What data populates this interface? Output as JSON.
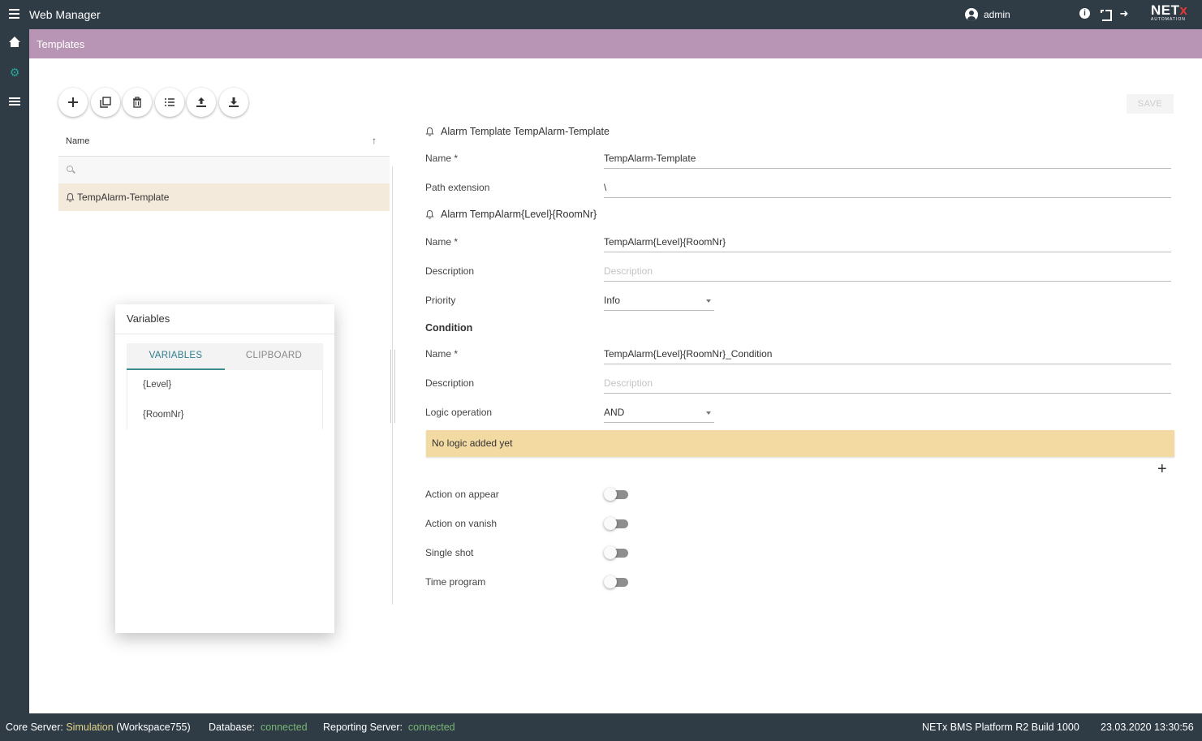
{
  "app": {
    "title": "Web Manager",
    "user": "admin",
    "logo_brand": "NET",
    "logo_brand_x": "x",
    "logo_sub": "AUTOMATION"
  },
  "page": {
    "title": "Templates"
  },
  "toolbar": {
    "save_label": "SAVE"
  },
  "list": {
    "column_name": "Name",
    "search_placeholder": "",
    "rows": [
      {
        "label": "TempAlarm-Template"
      }
    ]
  },
  "variables_dialog": {
    "title": "Variables",
    "tabs": [
      {
        "label": "VARIABLES",
        "active": true
      },
      {
        "label": "CLIPBOARD",
        "active": false
      }
    ],
    "items": [
      "{Level}",
      "{RoomNr}"
    ]
  },
  "form": {
    "template_header": "Alarm Template TempAlarm-Template",
    "template_name_label": "Name *",
    "template_name_value": "TempAlarm-Template",
    "path_extension_label": "Path extension",
    "path_extension_value": "\\",
    "alarm_header": "Alarm TempAlarm{Level}{RoomNr}",
    "alarm_name_label": "Name *",
    "alarm_name_value": "TempAlarm{Level}{RoomNr}",
    "alarm_description_label": "Description",
    "alarm_description_placeholder": "Description",
    "priority_label": "Priority",
    "priority_value": "Info",
    "condition_header": "Condition",
    "condition_name_label": "Name *",
    "condition_name_value": "TempAlarm{Level}{RoomNr}_Condition",
    "condition_description_label": "Description",
    "condition_description_placeholder": "Description",
    "logic_operation_label": "Logic operation",
    "logic_operation_value": "AND",
    "logic_banner": "No logic added yet",
    "toggles": [
      {
        "label": "Action on appear",
        "on": false
      },
      {
        "label": "Action on vanish",
        "on": false
      },
      {
        "label": "Single shot",
        "on": false
      },
      {
        "label": "Time program",
        "on": false
      }
    ]
  },
  "status": {
    "core_server_label": "Core Server:",
    "core_server_value": "Simulation",
    "core_server_workspace": "(Workspace755)",
    "database_label": "Database:",
    "database_value": "connected",
    "reporting_label": "Reporting Server:",
    "reporting_value": "connected",
    "platform": "NETx BMS Platform R2 Build 1000",
    "datetime": "23.03.2020 13:30:56"
  },
  "colors": {
    "header": "#2f3b45",
    "title_bar": "#b895b4",
    "selected_row": "#f4eadc",
    "banner": "#f3daa3",
    "accent": "#2e7d8c"
  }
}
